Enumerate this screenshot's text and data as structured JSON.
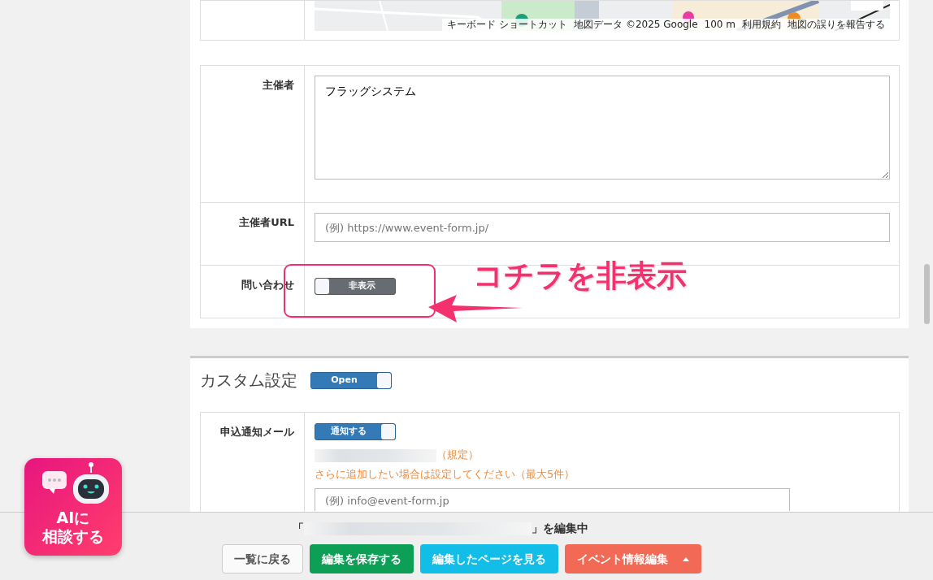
{
  "map": {
    "footer_links": [
      "キーボード ショートカット",
      "地図データ ©2025 Google",
      "100 m",
      "利用規約",
      "地図の誤りを報告する"
    ]
  },
  "event_fields": [
    {
      "kind": "textarea",
      "label": "主催者",
      "value": "フラッグシステム"
    },
    {
      "kind": "input",
      "label": "主催者URL",
      "placeholder": "(例) https://www.event-form.jp/"
    },
    {
      "kind": "toggle",
      "label": "問い合わせ",
      "toggle": {
        "label": "非表示",
        "on": false
      }
    }
  ],
  "annotation": {
    "text": "コチラを非表示"
  },
  "custom_settings": {
    "title": "カスタム設定",
    "toggle": {
      "label": "Open",
      "on": true
    },
    "rows": [
      {
        "label": "申込通知メール",
        "toggle": {
          "label": "通知する",
          "on": true
        },
        "default_note": "（規定）",
        "help": "さらに追加したい場合は設定してください（最大5件）",
        "email_placeholder": "(例) info@event-form.jp"
      }
    ]
  },
  "footer": {
    "editing_prefix": "「",
    "editing_suffix": "」を編集中",
    "buttons": [
      {
        "label": "一覧に戻る",
        "kind": "back"
      },
      {
        "label": "編集を保存する",
        "kind": "save"
      },
      {
        "label": "編集したページを見る",
        "kind": "view"
      },
      {
        "label": "イベント情報編集",
        "kind": "dropdown"
      }
    ]
  },
  "ai_button": {
    "lines": [
      "AIに",
      "相談する"
    ]
  }
}
